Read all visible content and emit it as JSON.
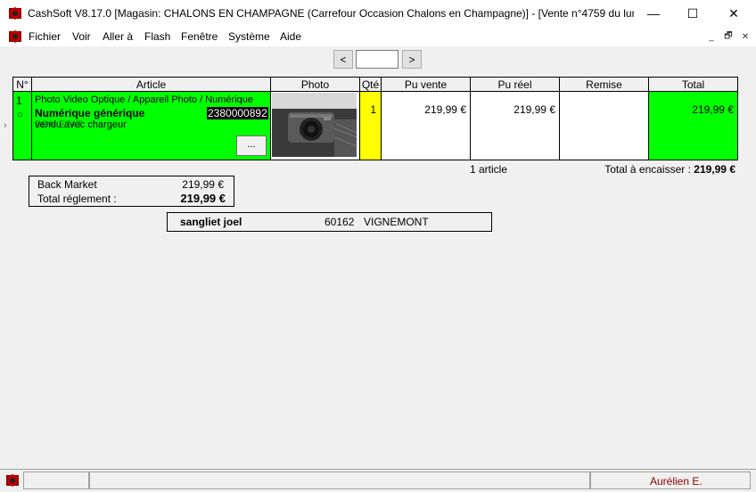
{
  "window": {
    "title": "CashSoft V8.17.0 [Magasin: CHALONS EN CHAMPAGNE (Carrefour Occasion Chalons en Champagne)] - [Vente n°4759 du lun...",
    "minimize": "—",
    "maximize": "☐",
    "close": "✕"
  },
  "menu": {
    "items": [
      "Fichier",
      "Voir",
      "Aller à",
      "Flash",
      "Fenêtre",
      "Système",
      "Aide"
    ],
    "mdi_minimize": "_",
    "mdi_restore": "🗗",
    "mdi_close": "✕"
  },
  "nav": {
    "prev": "<",
    "next": ">",
    "value": ""
  },
  "table": {
    "headers": [
      "N°",
      "Article",
      "Photo",
      "Qté",
      "Pu vente",
      "Pu réel",
      "Remise",
      "Total"
    ],
    "row": {
      "num": "1",
      "circle": "○",
      "category": "Photo Video Optique / Appareil Photo / Numérique",
      "name": "Numérique générique",
      "barcode": "2380000892",
      "detail": "vendu avec chargeur",
      "overlap": "BON ETAT",
      "more_button": "...",
      "qty": "1",
      "pu_vente": "219,99 €",
      "pu_reel": "219,99 €",
      "remise": "",
      "total": "219,99 €"
    }
  },
  "summary": {
    "article_count": "1 article",
    "total_label": "Total à encaisser :",
    "total_value": "219,99 €"
  },
  "payment": {
    "method": "Back Market",
    "method_amount": "219,99 €",
    "total_label": "Total réglement :",
    "total_amount": "219,99 €"
  },
  "customer": {
    "name": "sangliet joel",
    "postcode": "60162",
    "city": "VIGNEMONT"
  },
  "status": {
    "user": "Aurélien E."
  },
  "colors": {
    "row_highlight": "#00ff00",
    "qty_cell": "#ffff00",
    "user_text": "#8b0000"
  }
}
